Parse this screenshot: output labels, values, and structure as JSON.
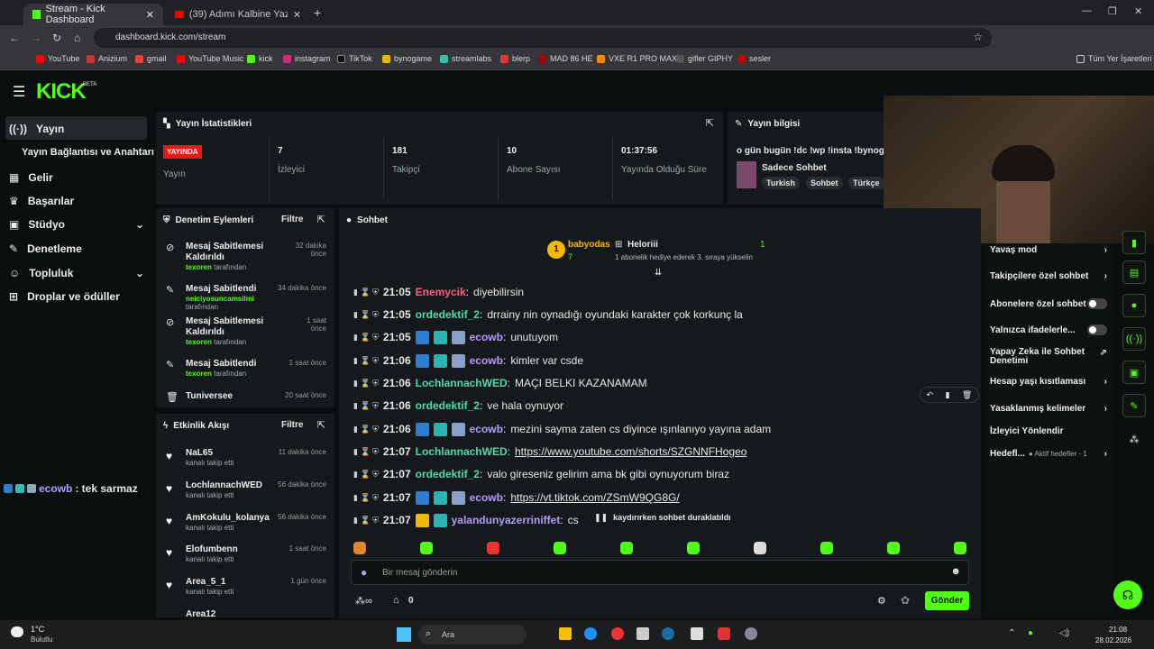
{
  "browser": {
    "tab1": "Stream - Kick Dashboard",
    "tab2": "(39) Adımı Kalbine Yaz - YouTub",
    "url": "dashboard.kick.com/stream",
    "bookmarks": [
      "YouTube",
      "Anizium",
      "gmail",
      "YouTube Music",
      "kick",
      "instagram",
      "TikTok",
      "bynogame",
      "streamlabs",
      "blerp",
      "MAD 86 HE",
      "VXE R1 PRO MAX",
      "gifler GIPHY",
      "sesler"
    ],
    "bookmarks_all": "Tüm Yer İşaretleri"
  },
  "kick": {
    "logo": "KICK",
    "beta": "BETA"
  },
  "sidebar": {
    "items": [
      "Yayın",
      "Yayın Bağlantısı ve Anahtarı",
      "Gelir",
      "Başarılar",
      "Stüdyo",
      "Denetleme",
      "Topluluk",
      "Droplar ve ödüller"
    ]
  },
  "stats": {
    "title": "Yayın İstatistikleri",
    "live": "YAYINDA",
    "live_lbl": "Yayın",
    "items": [
      {
        "num": "7",
        "lbl": "İzleyici"
      },
      {
        "num": "181",
        "lbl": "Takipçi"
      },
      {
        "num": "10",
        "lbl": "Abone Sayısı"
      },
      {
        "num": "01:37:56",
        "lbl": "Yayında Olduğu Süre"
      }
    ]
  },
  "info": {
    "title": "Yayın bilgisi",
    "stream_title": "o gün bugün !dc !wp !insta !bynogam",
    "category": "Sadece Sohbet",
    "tags": [
      "Turkish",
      "Sohbet",
      "Türkçe"
    ]
  },
  "mod": {
    "title": "Denetim Eylemleri",
    "filter": "Filtre",
    "by": "tarafından",
    "items": [
      {
        "title": "Mesaj Sabitlemesi Kaldırıldı",
        "user": "texoren",
        "time": "32 dakika önce"
      },
      {
        "title": "Mesaj Sabitlendi",
        "user": "neiciyosuncamsilmi",
        "time": "34 dakika önce"
      },
      {
        "title": "Mesaj Sabitlemesi Kaldırıldı",
        "user": "texoren",
        "time": "1 saat önce"
      },
      {
        "title": "Mesaj Sabitlendi",
        "user": "texoren",
        "time": "1 saat önce"
      },
      {
        "title": "Tuniversee",
        "user": "",
        "time": "20 saat önce"
      }
    ]
  },
  "activity": {
    "title": "Etkinlik Akışı",
    "filter": "Filtre",
    "followed": "kanalı takip etti",
    "items": [
      {
        "name": "NaL65",
        "time": "11 dakika önce"
      },
      {
        "name": "LochlannachWED",
        "time": "56 dakika önce"
      },
      {
        "name": "AmKokulu_kolanya",
        "time": "56 dakika önce"
      },
      {
        "name": "Elofumbenn",
        "time": "1 saat önce"
      },
      {
        "name": "Area_5_1",
        "time": "1 gün önce"
      },
      {
        "name": "Area12",
        "time": ""
      }
    ]
  },
  "overlay": {
    "user": "ecowb",
    "text": ": tek sarmaz"
  },
  "chat": {
    "title": "Sohbet",
    "top_gifter": "babyodas",
    "top_count": "7",
    "helper": "Heloriii",
    "helper_count": "1",
    "helper_msg": "1 abonelik hediye ederek 3. sıraya yükselin",
    "paused": "kaydırırken sohbet duraklatıldı",
    "placeholder": "Bir mesaj gönderin",
    "points": "0",
    "send": "Gönder",
    "messages": [
      {
        "time": "21:05",
        "user": "Enemycik",
        "color": "#ff5f7e",
        "text": "diyebilirsin",
        "b": 0
      },
      {
        "time": "21:05",
        "user": "ordedektif_2",
        "color": "#53d9a8",
        "text": "drrainy nin oynadığı oyundaki karakter çok korkunç la",
        "b": 0
      },
      {
        "time": "21:05",
        "user": "ecowb",
        "color": "#b59cff",
        "text": "unutuyom",
        "b": 3
      },
      {
        "time": "21:06",
        "user": "ecowb",
        "color": "#b59cff",
        "text": "kimler var csde",
        "b": 3
      },
      {
        "time": "21:06",
        "user": "LochlannachWED",
        "color": "#53d9a8",
        "text": "MAÇI BELKI KAZANAMAM",
        "b": 0
      },
      {
        "time": "21:06",
        "user": "ordedektif_2",
        "color": "#53d9a8",
        "text": "ve hala oynuyor",
        "b": 0
      },
      {
        "time": "21:06",
        "user": "ecowb",
        "color": "#b59cff",
        "text": "mezini sayma zaten cs diyince ışınlanıyo yayına adam",
        "b": 3
      },
      {
        "time": "21:07",
        "user": "LochlannachWED",
        "color": "#53d9a8",
        "text": "https://www.youtube.com/shorts/SZGNNFHogeo",
        "b": 0
      },
      {
        "time": "21:07",
        "user": "ordedektif_2",
        "color": "#53d9a8",
        "text": "valo gireseniz gelirim ama bk gibi oynuyorum biraz",
        "b": 0
      },
      {
        "time": "21:07",
        "user": "ecowb",
        "color": "#b59cff",
        "text": "https://vt.tiktok.com/ZSmW9QG8G/",
        "b": 3
      },
      {
        "time": "21:07",
        "user": "yalandunyazerriniffet",
        "color": "#b59cff",
        "text": "cs",
        "b": 2
      }
    ]
  },
  "settings": {
    "items": [
      "Yavaş mod",
      "Takipçilere özel sohbet",
      "Abonelere özel sohbet",
      "Yalnızca ifadelerle...",
      "Yapay Zeka ile Sohbet Denetimi",
      "Hesap yaşı kısıtlaması",
      "Yasaklanmış kelimeler",
      "İzleyici Yönlendir",
      "Hedefl..."
    ],
    "goals": "Aktif hedefler - 1"
  },
  "taskbar": {
    "temp": "1°C",
    "weather": "Bulutlu",
    "search": "Ara",
    "time": "21:08",
    "date": "28.02.2026"
  },
  "colors": {
    "accent": "#53fc18",
    "live": "#e91916"
  }
}
